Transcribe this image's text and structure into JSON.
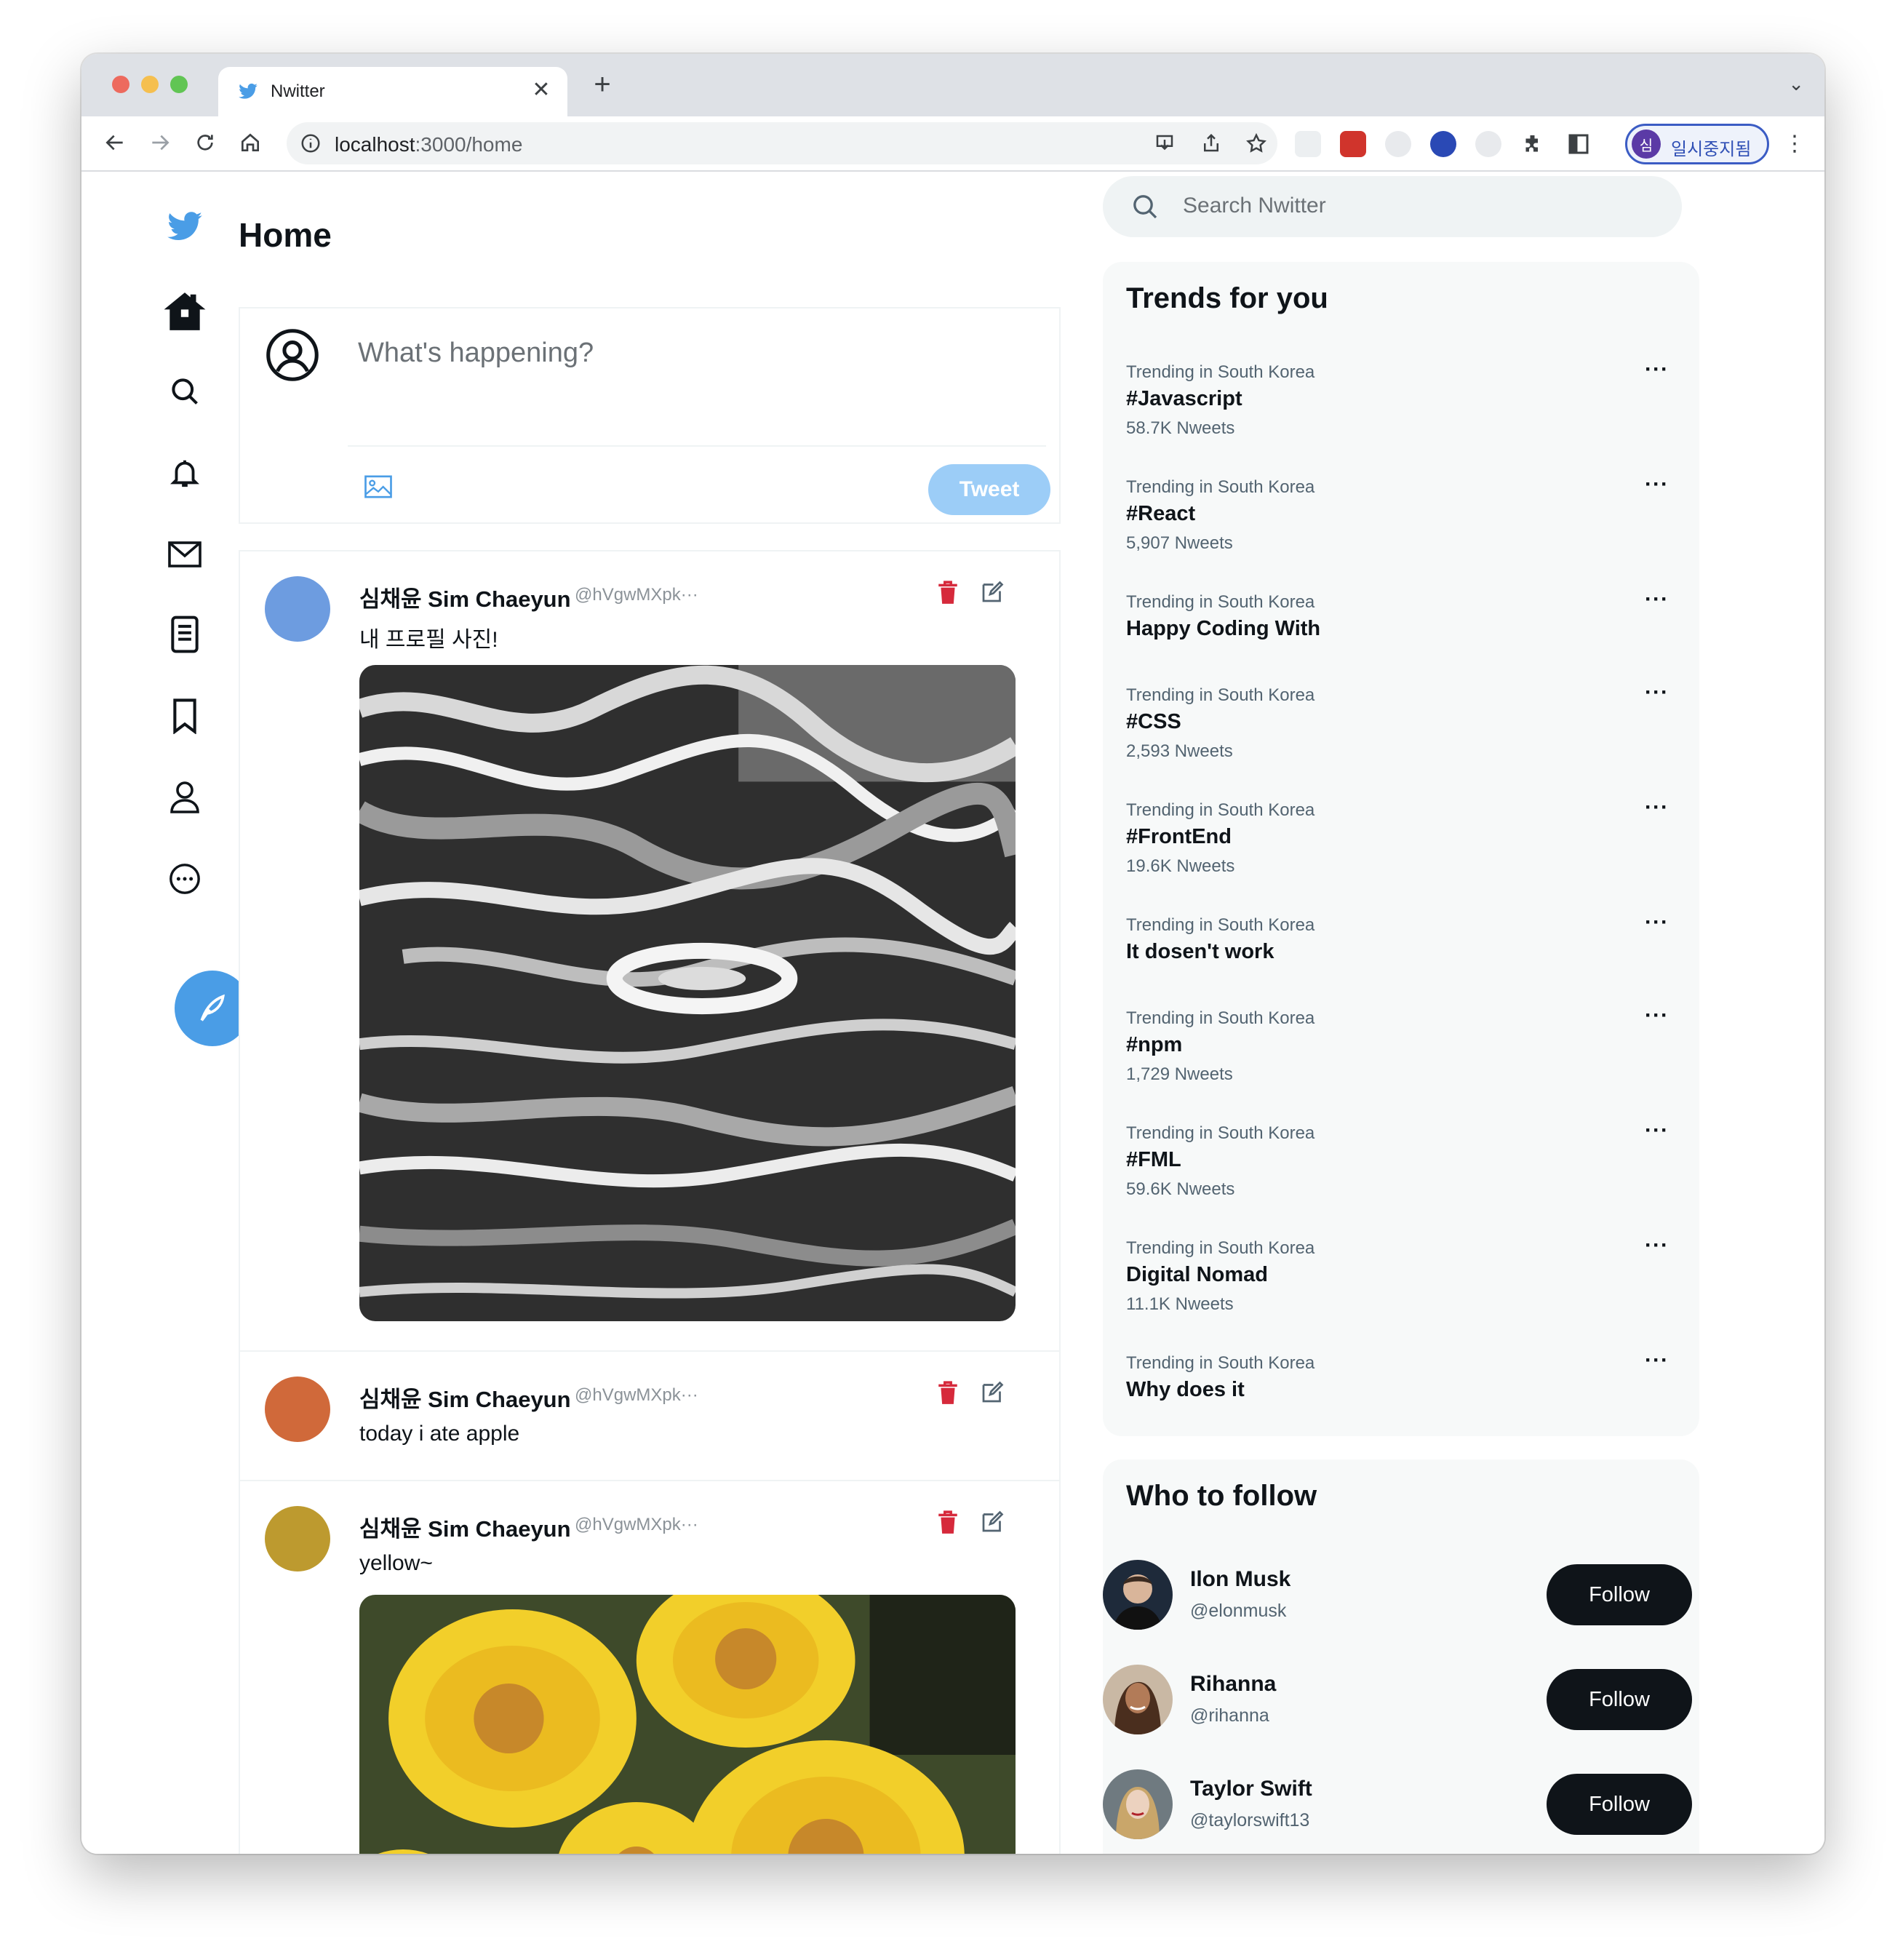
{
  "browser": {
    "tab_title": "Nwitter",
    "url_host": "localhost",
    "url_rest": ":3000/home",
    "profile_initial": "심",
    "profile_label": "일시중지됨"
  },
  "sidebar": {
    "items": [
      {
        "icon": "twitter-logo-icon"
      },
      {
        "icon": "home-icon"
      },
      {
        "icon": "search-icon"
      },
      {
        "icon": "bell-icon"
      },
      {
        "icon": "mail-icon"
      },
      {
        "icon": "list-icon"
      },
      {
        "icon": "bookmark-icon"
      },
      {
        "icon": "profile-icon"
      },
      {
        "icon": "more-icon"
      },
      {
        "icon": "compose-icon"
      }
    ]
  },
  "main": {
    "title": "Home",
    "composer": {
      "placeholder": "What's happening?",
      "tweet_label": "Tweet"
    },
    "tweets": [
      {
        "name": "심채윤 Sim Chaeyun",
        "handle": "@hVgwMXpk···",
        "text": "내 프로필 사진!",
        "avatar_color": "#6d9ce0",
        "image": "abstract-monochrome-swirl"
      },
      {
        "name": "심채윤 Sim Chaeyun",
        "handle": "@hVgwMXpk···",
        "text": "today i ate apple",
        "avatar_color": "#d0693a"
      },
      {
        "name": "심채윤 Sim Chaeyun",
        "handle": "@hVgwMXpk···",
        "text": "yellow~",
        "avatar_color": "#bd9a2f",
        "image": "yellow-daisies"
      }
    ]
  },
  "search": {
    "placeholder": "Search Nwitter"
  },
  "trends": {
    "title": "Trends for you",
    "items": [
      {
        "meta": "Trending in South Korea",
        "name": "#Javascript",
        "count": "58.7K Nweets"
      },
      {
        "meta": "Trending in South Korea",
        "name": "#React",
        "count": "5,907 Nweets"
      },
      {
        "meta": "Trending in South Korea",
        "name": "Happy Coding With",
        "count": ""
      },
      {
        "meta": "Trending in South Korea",
        "name": "#CSS",
        "count": "2,593 Nweets"
      },
      {
        "meta": "Trending in South Korea",
        "name": "#FrontEnd",
        "count": "19.6K Nweets"
      },
      {
        "meta": "Trending in South Korea",
        "name": "It dosen't work",
        "count": ""
      },
      {
        "meta": "Trending in South Korea",
        "name": "#npm",
        "count": "1,729 Nweets"
      },
      {
        "meta": "Trending in South Korea",
        "name": "#FML",
        "count": "59.6K Nweets"
      },
      {
        "meta": "Trending in South Korea",
        "name": "Digital Nomad",
        "count": "11.1K Nweets"
      },
      {
        "meta": "Trending in South Korea",
        "name": "Why does it",
        "count": ""
      }
    ],
    "more_label": "···"
  },
  "who_to_follow": {
    "title": "Who to follow",
    "users": [
      {
        "name": "Ilon Musk",
        "handle": "@elonmusk",
        "button": "Follow"
      },
      {
        "name": "Rihanna",
        "handle": "@rihanna",
        "button": "Follow"
      },
      {
        "name": "Taylor Swift",
        "handle": "@taylorswift13",
        "button": "Follow"
      }
    ]
  },
  "colors": {
    "brand_blue": "#4a9de6",
    "tweet_button_disabled": "#9ccdf7",
    "delete_red": "#e0245e",
    "follow_button": "#0f1419"
  }
}
